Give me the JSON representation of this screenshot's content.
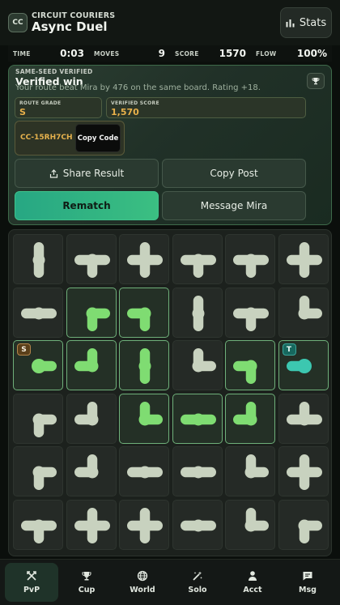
{
  "header": {
    "logo": "CC",
    "brand": "CIRCUIT COURIERS",
    "title": "Async Duel",
    "stats_label": "Stats",
    "stats_icon": "bar-chart-icon"
  },
  "hud": [
    {
      "label": "TIME",
      "value": "0:03"
    },
    {
      "label": "MOVES",
      "value": "9"
    },
    {
      "label": "SCORE",
      "value": "1570"
    },
    {
      "label": "FLOW",
      "value": "100%"
    }
  ],
  "result": {
    "kicker": "SAME-SEED VERIFIED",
    "title": "Verified win",
    "subtitle": "Your route beat Mira by 476 on the same board. Rating +18.",
    "trophy_icon": "trophy-icon",
    "grade_label": "ROUTE GRADE",
    "grade_value": "S",
    "score_label": "VERIFIED SCORE",
    "score_value": "1,570",
    "code": "CC-15RH7CH",
    "copy_code": "Copy Code",
    "share_result": "Share Result",
    "copy_post": "Copy Post",
    "rematch": "Rematch",
    "message": "Message Mira"
  },
  "board": {
    "start_tag": "S",
    "target_tag": "T",
    "colors": {
      "pipe": "#c8d2bf",
      "flow": "#7fdc72",
      "target": "#3cc7b0"
    },
    "tiles": [
      [
        {
          "o": "NS",
          "st": "d"
        },
        {
          "o": "EWS",
          "st": "d"
        },
        {
          "o": "NSEW",
          "st": "d"
        },
        {
          "o": "EWS",
          "st": "d"
        },
        {
          "o": "EWS",
          "st": "d"
        },
        {
          "o": "NSEW",
          "st": "d"
        }
      ],
      [
        {
          "o": "EW",
          "st": "d"
        },
        {
          "o": "ES",
          "st": "f"
        },
        {
          "o": "WS",
          "st": "f"
        },
        {
          "o": "NS",
          "st": "d"
        },
        {
          "o": "EWS",
          "st": "d"
        },
        {
          "o": "NE",
          "st": "d"
        }
      ],
      [
        {
          "o": "E",
          "st": "f",
          "tag": "S"
        },
        {
          "o": "NW",
          "st": "f"
        },
        {
          "o": "NS",
          "st": "f"
        },
        {
          "o": "NE",
          "st": "d"
        },
        {
          "o": "WS",
          "st": "f"
        },
        {
          "o": "W",
          "st": "t",
          "tag": "T"
        }
      ],
      [
        {
          "o": "ES",
          "st": "d"
        },
        {
          "o": "NW",
          "st": "d"
        },
        {
          "o": "NE",
          "st": "f"
        },
        {
          "o": "EW",
          "st": "f"
        },
        {
          "o": "NW",
          "st": "f"
        },
        {
          "o": "NEW",
          "st": "d"
        }
      ],
      [
        {
          "o": "ES",
          "st": "d"
        },
        {
          "o": "NW",
          "st": "d"
        },
        {
          "o": "EW",
          "st": "d"
        },
        {
          "o": "EW",
          "st": "d"
        },
        {
          "o": "NE",
          "st": "d"
        },
        {
          "o": "NSEW",
          "st": "d"
        }
      ],
      [
        {
          "o": "EWS",
          "st": "d"
        },
        {
          "o": "NSEW",
          "st": "d"
        },
        {
          "o": "NSEW",
          "st": "d"
        },
        {
          "o": "EW",
          "st": "d"
        },
        {
          "o": "NE",
          "st": "d"
        },
        {
          "o": "ES",
          "st": "d"
        }
      ]
    ]
  },
  "nav": [
    {
      "label": "PvP",
      "icon": "swords-icon",
      "active": true
    },
    {
      "label": "Cup",
      "icon": "trophy-icon",
      "active": false
    },
    {
      "label": "World",
      "icon": "globe-icon",
      "active": false
    },
    {
      "label": "Solo",
      "icon": "wand-icon",
      "active": false
    },
    {
      "label": "Acct",
      "icon": "person-icon",
      "active": false
    },
    {
      "label": "Msg",
      "icon": "message-icon",
      "active": false
    }
  ]
}
